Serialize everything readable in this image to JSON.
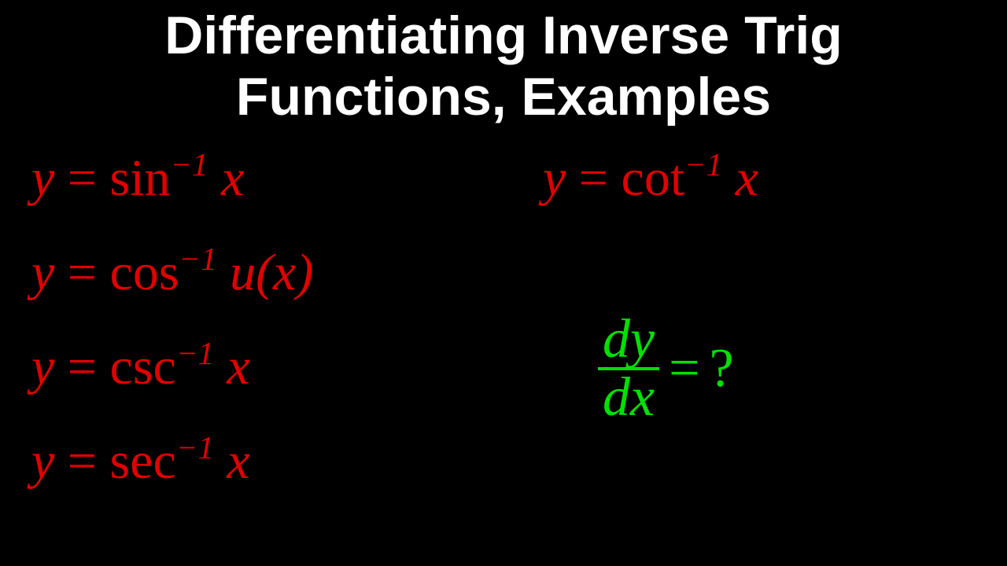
{
  "title_line1": "Differentiating Inverse Trig",
  "title_line2": "Functions, Examples",
  "equations": {
    "e1": {
      "lhs": "y",
      "fn": "sin",
      "exp": "−1",
      "arg": "x"
    },
    "e2": {
      "lhs": "y",
      "fn": "cos",
      "exp": "−1",
      "arg": "u(x)"
    },
    "e3": {
      "lhs": "y",
      "fn": "csc",
      "exp": "−1",
      "arg": "x"
    },
    "e4": {
      "lhs": "y",
      "fn": "sec",
      "exp": "−1",
      "arg": "x"
    },
    "e5": {
      "lhs": "y",
      "fn": "cot",
      "exp": "−1",
      "arg": "x"
    }
  },
  "derivative": {
    "num": "dy",
    "den": "dx",
    "eq": "=",
    "q": "?"
  },
  "colors": {
    "background": "#000000",
    "title": "#FFFFFF",
    "equations": "#E00000",
    "derivative": "#00E000"
  }
}
